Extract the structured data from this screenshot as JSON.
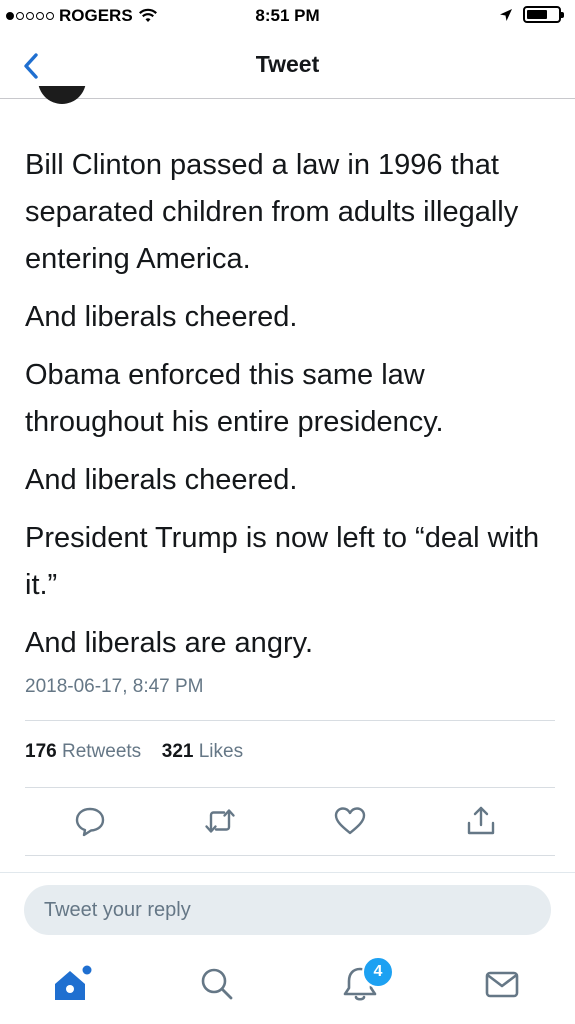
{
  "status_bar": {
    "carrier": "ROGERS",
    "signal_bars": 1,
    "time": "8:51 PM",
    "battery_level": 0.65
  },
  "nav": {
    "title": "Tweet",
    "back_icon": "chevron-left-icon"
  },
  "tweet": {
    "paragraphs": [
      "Bill Clinton passed a law in 1996 that separated children from adults illegally entering America.",
      "And liberals cheered.",
      "Obama enforced this same law throughout his entire presidency.",
      "And liberals cheered.",
      "President Trump is now left to “deal with it.”",
      "And liberals are angry."
    ],
    "timestamp": "2018-06-17, 8:47 PM",
    "retweets_count": "176",
    "retweets_label": "Retweets",
    "likes_count": "321",
    "likes_label": "Likes"
  },
  "actions": [
    "reply-icon",
    "retweet-icon",
    "like-icon",
    "share-icon"
  ],
  "reply_box": {
    "placeholder": "Tweet your reply"
  },
  "tab_bar": {
    "items": [
      "home-icon",
      "search-icon",
      "notifications-icon",
      "messages-icon"
    ],
    "notifications_badge": "4"
  },
  "colors": {
    "accent": "#1da1f2",
    "nav_accent": "#1f6fd0",
    "text_primary": "#14171a",
    "text_secondary": "#657786",
    "divider": "#d8dde2",
    "reply_bg": "#e6ecf0"
  }
}
